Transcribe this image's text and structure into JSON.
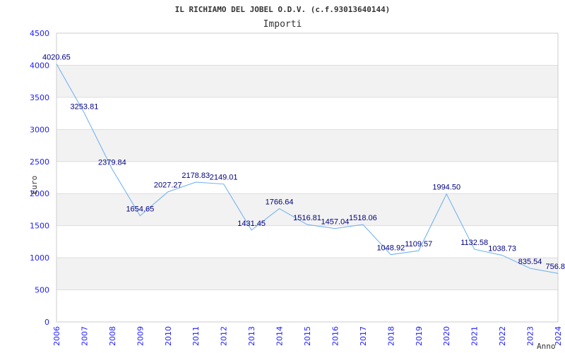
{
  "chart_data": {
    "type": "line",
    "title": "IL RICHIAMO DEL JOBEL O.D.V. (c.f.93013640144)",
    "subtitle": "Importi",
    "xlabel": "Anno",
    "ylabel": "Euro",
    "ylim": [
      0,
      4500
    ],
    "yticks": [
      0,
      500,
      1000,
      1500,
      2000,
      2500,
      3000,
      3500,
      4000,
      4500
    ],
    "grid": true,
    "categories": [
      "2006",
      "2007",
      "2008",
      "2009",
      "2010",
      "2011",
      "2012",
      "2013",
      "2014",
      "2015",
      "2016",
      "2017",
      "2018",
      "2019",
      "2020",
      "2021",
      "2022",
      "2023",
      "2024"
    ],
    "values": [
      4020.65,
      3253.81,
      2379.84,
      1654.65,
      2027.27,
      2178.83,
      2149.01,
      1431.45,
      1766.64,
      1516.81,
      1457.04,
      1518.06,
      1048.92,
      1109.57,
      1994.5,
      1132.58,
      1038.73,
      835.54,
      756.8
    ],
    "labels": [
      "4020.65",
      "3253.81",
      "2379.84",
      "1654.65",
      "2027.27",
      "2178.83",
      "2149.01",
      "1431.45",
      "1766.64",
      "1516.81",
      "1457.04",
      "1518.06",
      "1048.92",
      "1109.57",
      "1994.50",
      "1132.58",
      "1038.73",
      "835.54",
      "756.8"
    ],
    "colors": {
      "line": "#6aaef0",
      "tick": "#2020ff",
      "label": "#000080",
      "band": "#f2f2f2"
    }
  }
}
